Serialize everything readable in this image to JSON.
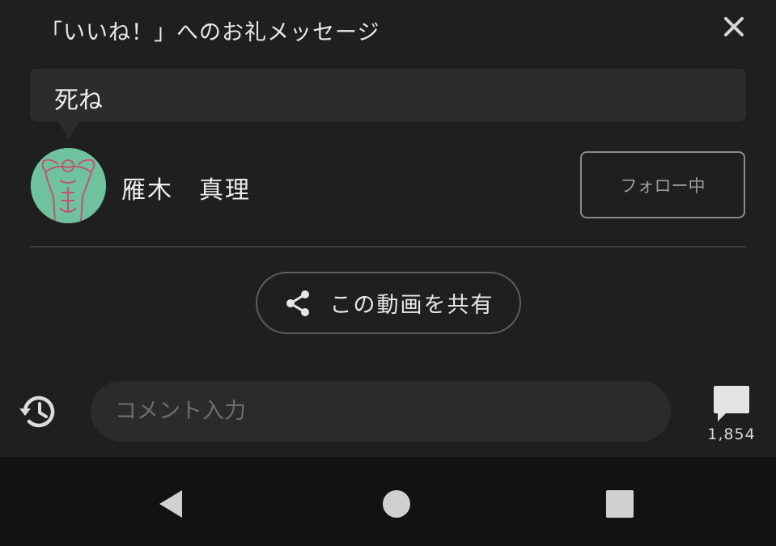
{
  "dialog": {
    "title": "「いいね！」へのお礼メッセージ",
    "close_icon": "close-icon",
    "message": "死ね"
  },
  "user": {
    "name": "雁木　真理",
    "avatar_color": "#6fc2a0",
    "follow_label": "フォロー中"
  },
  "share": {
    "label": "この動画を共有",
    "icon": "share-icon"
  },
  "comment_bar": {
    "history_icon": "history-icon",
    "placeholder": "コメント入力",
    "comment_icon": "comment-icon",
    "count": "1,854"
  },
  "navbar": {
    "back_icon": "back-triangle-icon",
    "home_icon": "home-circle-icon",
    "recents_icon": "recents-square-icon"
  },
  "colors": {
    "background": "#1f1f1f",
    "bubble": "#2c2c2c",
    "navbar": "#121212",
    "text": "#e6e6e6"
  }
}
